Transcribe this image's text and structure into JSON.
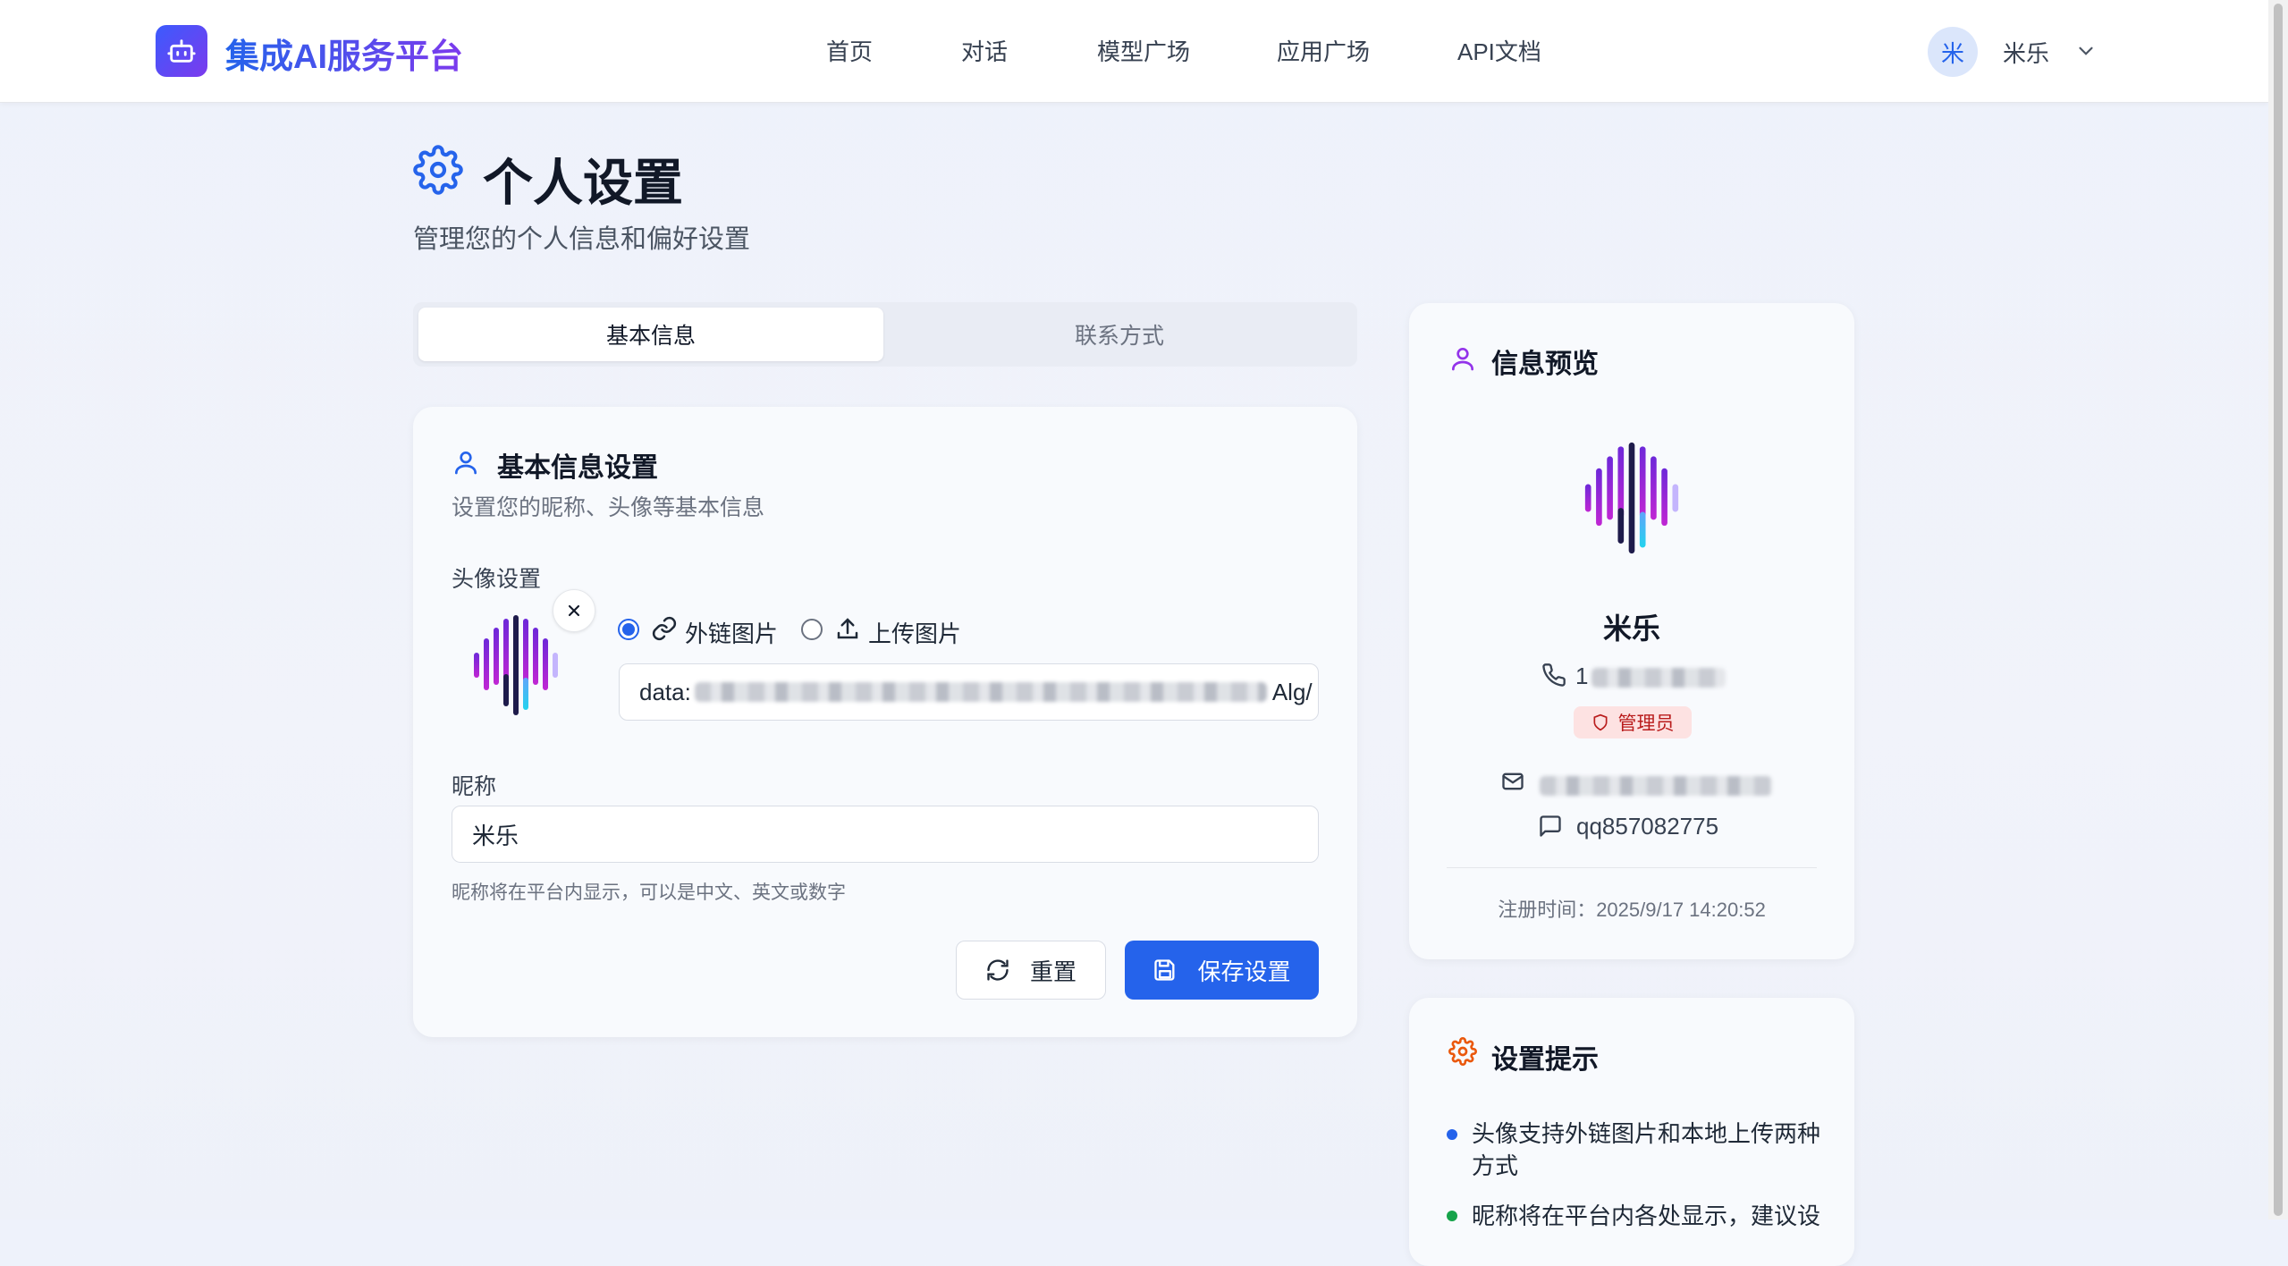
{
  "header": {
    "brand": "集成AI服务平台",
    "nav": [
      "首页",
      "对话",
      "模型广场",
      "应用广场",
      "API文档"
    ],
    "user_initial": "米",
    "user_name": "米乐"
  },
  "page": {
    "title": "个人设置",
    "subtitle": "管理您的个人信息和偏好设置"
  },
  "tabs": {
    "basic": "基本信息",
    "contact": "联系方式"
  },
  "basic_section": {
    "title": "基本信息设置",
    "description": "设置您的昵称、头像等基本信息",
    "avatar_label": "头像设置",
    "option_link": "外链图片",
    "option_upload": "上传图片",
    "avatar_url_prefix": "data:",
    "avatar_url_suffix": "Alg/",
    "nickname_label": "昵称",
    "nickname_value": "米乐",
    "nickname_hint": "昵称将在平台内显示，可以是中文、英文或数字",
    "reset_label": "重置",
    "save_label": "保存设置"
  },
  "preview": {
    "title": "信息预览",
    "name": "米乐",
    "phone_prefix": "1",
    "role": "管理员",
    "qq": "qq857082775",
    "registered": "注册时间：2025/9/17 14:20:52"
  },
  "tips": {
    "title": "设置提示",
    "items": [
      "头像支持外链图片和本地上传两种方式",
      "昵称将在平台内各处显示，建议设"
    ]
  },
  "colors": {
    "primary": "#2563eb",
    "brand_gradient_end": "#7c3aed",
    "badge_bg": "#fde2e2",
    "badge_text": "#b91c1c"
  }
}
